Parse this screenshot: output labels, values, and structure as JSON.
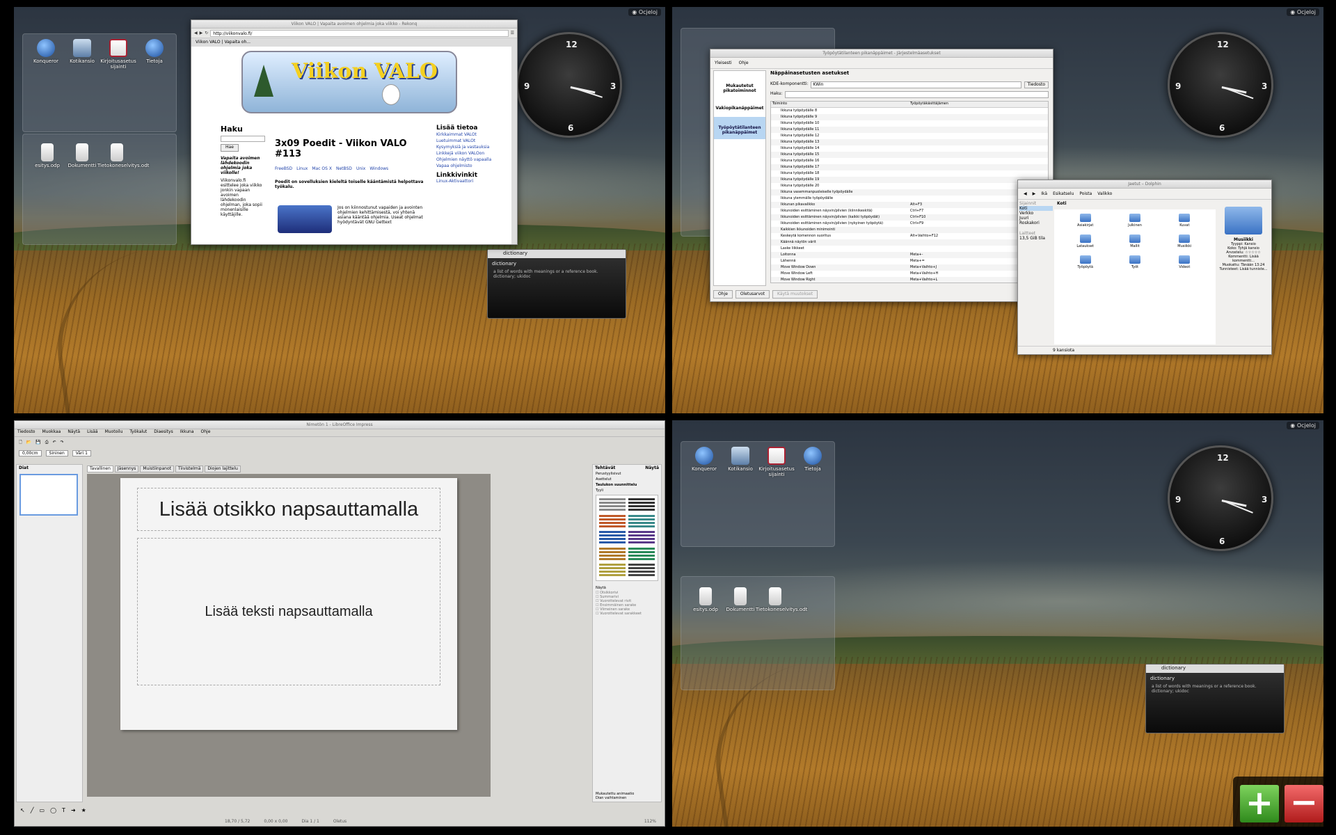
{
  "desktop": {
    "cashew_label": "Ocjeloj",
    "icons_top": [
      "Konqueror",
      "Kotikansio",
      "Kirjoitusasetus sijainti",
      "Tietoja"
    ],
    "icons_folder": [
      "esitys.odp",
      "Dokumentti",
      "Tietokoneselvitys.odt"
    ]
  },
  "clock": {
    "n12": "12",
    "n3": "3",
    "n6": "6",
    "n9": "9"
  },
  "dictionary": {
    "title": "dictionary",
    "heading": "dictionary",
    "text": "a list of words with meanings or a reference book. dictionary; ukidoc"
  },
  "browser": {
    "title": "Viikon VALO | Vapaita avoimen ohjelmia joka viikko - Rekonq",
    "url": "http://viikonvalo.fi/",
    "tab": "Viikon VALO | Vapaita oh...",
    "banner": "Viikon VALO",
    "search_heading": "Haku",
    "search_button": "Hae",
    "tagline": "Vapaita avoimen lähdekoodin ohjelmia joka viikolle!",
    "intro": "Viikonvalo.fi esittelee joka viikko jonkin vapaan avoimen lähdekoodin ohjelman, joka sopii monenlaisille käyttäjille.",
    "article_title": "3x09 Poedit - Viikon VALO #113",
    "platforms": [
      "FreeBSD",
      "Linux",
      "Mac OS X",
      "NetBSD",
      "Unix",
      "Windows"
    ],
    "lead": "Poedit on sovelluksien kieleltä toiselle kääntämistä helpottava työkalu.",
    "body": "Jos on kiinnostunut vapaiden ja avointen ohjelmien kehittämisestä, voi yhtenä asiana kääntää ohjelmia. Useat ohjelmat hyödyntävät GNU Gettext",
    "more_heading": "Lisää tietoa",
    "links": [
      "Kirkkaimmat VALOt",
      "Luetuimmat VALOt",
      "Kysymyksiä ja vastauksia",
      "Linkkejä viikon VALOon",
      "Ohjelmien näyttö vapaalla",
      "Vapaa ohjelmisto"
    ],
    "linkkivinkit": "Linkkivinkit",
    "link2": "Linux-Aktivaattori"
  },
  "shortcuts": {
    "title": "Työpöytätilanteen pikanäppäimet - Järjestelmäasetukset",
    "toolbar": [
      "Yleisesti",
      "Ohje"
    ],
    "side": [
      "Mukautetut pikatoiminnot",
      "Vakiopikanäppäimet",
      "Työpöytätilanteen pikanäppäimet"
    ],
    "heading": "Näppäinasetusten asetukset",
    "component_label": "KDE-komponentti:",
    "component_value": "KWin",
    "file_button": "Tiedosto",
    "search_label": "Haku:",
    "col_action": "Toiminto",
    "col_shortcut": "Työpöytäkäsittäjämen",
    "rows": [
      [
        "Ikkuna työpöydälle 8",
        ""
      ],
      [
        "Ikkuna työpöydälle 9",
        ""
      ],
      [
        "Ikkuna työpöydälle 10",
        ""
      ],
      [
        "Ikkuna työpöydälle 11",
        ""
      ],
      [
        "Ikkuna työpöydälle 12",
        ""
      ],
      [
        "Ikkuna työpöydälle 13",
        ""
      ],
      [
        "Ikkuna työpöydälle 14",
        ""
      ],
      [
        "Ikkuna työpöydälle 15",
        ""
      ],
      [
        "Ikkuna työpöydälle 16",
        ""
      ],
      [
        "Ikkuna työpöydälle 17",
        ""
      ],
      [
        "Ikkuna työpöydälle 18",
        ""
      ],
      [
        "Ikkuna työpöydälle 19",
        ""
      ],
      [
        "Ikkuna työpöydälle 20",
        ""
      ],
      [
        "Ikkuna vasemmanpuoleiselle työpöydälle",
        ""
      ],
      [
        "Ikkuna ylemmälle työpöydälle",
        ""
      ],
      [
        "Ikkunan pikavalikko",
        "Alt+F3"
      ],
      [
        "Ikkunoiden esittäminen näyvin/pilvien (kiinnikeskitä)",
        "Ctrl+F7"
      ],
      [
        "Ikkunoiden esittäminen näyvin/pilvien (kaikki työpöydät)",
        "Ctrl+F10"
      ],
      [
        "Ikkunoiden esittäminen näyvin/pilvien (nykyinen työpöytä)",
        "Ctrl+F9"
      ],
      [
        "Kaikkien ikkunoiden minimointi",
        ""
      ],
      [
        "Keskeytä komennon suoritus",
        "Alt+Vaihto+F12"
      ],
      [
        "Käännä näytön värit",
        ""
      ],
      [
        "Laske liikkeet",
        ""
      ],
      [
        "Loitonna",
        "Meta+-"
      ],
      [
        "Lähennä",
        "Meta+="
      ],
      [
        "Move Window Down",
        "Meta+Vaihto+J"
      ],
      [
        "Move Window Left",
        "Meta+Vaihto+H"
      ],
      [
        "Move Window Right",
        "Meta+Vaihto+L"
      ]
    ],
    "btn_help": "Ohje",
    "btn_defaults": "Oletusarvot",
    "btn_apply": "Käytä muutokset"
  },
  "dolphin": {
    "title": "Jaetut – Dolphin",
    "toolbar": [
      "Ikä",
      "Esikatselu",
      "Poista",
      "Valikko"
    ],
    "places_heading": "Sijainnit",
    "places": [
      "Koti",
      "Verkko",
      "Juuri",
      "Roskakori"
    ],
    "devices_heading": "Laitteet",
    "device": "13,5 GiB tila",
    "breadcrumb": "Koti",
    "folders": [
      "Asiakirjat",
      "Julkinen",
      "Kuvat",
      "Lataukset",
      "Mallit",
      "Musiikki",
      "Työpöytä",
      "Työt",
      "Videot"
    ],
    "info_name": "Musiikki",
    "info_rows": [
      "Tyyppi: Kansio",
      "Koko: Tyhjä kansio",
      "Arvostelu: ☆☆☆☆☆",
      "Kommentti: Lisää kommentti...",
      "Muokattu: Tänään 13:24",
      "Tunnisteet: Lisää tunniste..."
    ],
    "status": "9 kansiota"
  },
  "impress": {
    "title": "Nimetön 1 - LibreOffice Impress",
    "menu": [
      "Tiedosto",
      "Muokkaa",
      "Näytä",
      "Lisää",
      "Muotoilu",
      "Työkalut",
      "Diaesitys",
      "Ikkuna",
      "Ohje"
    ],
    "zoom_field": "0,00cm",
    "color_field": "Sininen",
    "font_field": "Väri 1",
    "slides_panel": "Diat",
    "view_tabs": [
      "Tavallinen",
      "Jäsennys",
      "Muistiinpanot",
      "Tiivistelmä",
      "Diojen lajittelu"
    ],
    "title_placeholder": "Lisää otsikko napsauttamalla",
    "body_placeholder": "Lisää teksti napsauttamalla",
    "tasks_heading": "Tehtävät",
    "tasks_view": "Näytä",
    "tasks_sections": [
      "Perustyylisivut",
      "Asettelut",
      "Taulukon suunnittelu"
    ],
    "tasks_style": "Tyyli",
    "tasks_show": "Näytä",
    "tasks_checks": [
      "Otsikkorivi",
      "Summarivi",
      "Vuorottelevat rivit",
      "Ensimmäinen sarake",
      "Viimeinen sarake",
      "Vuorottelevat sarakkeet"
    ],
    "tasks_bottom": [
      "Mukautettu animaatio",
      "Dian vaihtaminen"
    ],
    "status_pos": "18,70 / 5,72",
    "status_size": "0,00 x 0,00",
    "status_slide": "Dia 1 / 1",
    "status_layout": "Oletus",
    "status_zoom": "112%"
  },
  "pager": {
    "add": "+",
    "remove": "−"
  }
}
